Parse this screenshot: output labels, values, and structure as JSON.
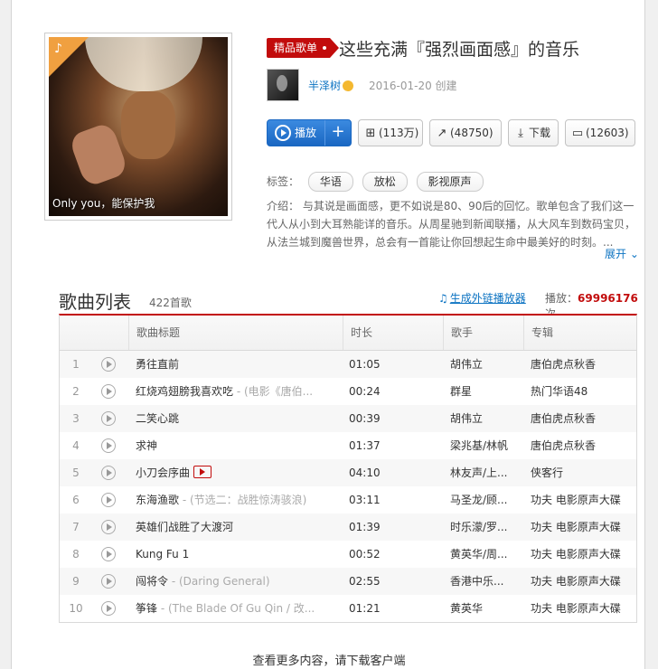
{
  "header": {
    "badge": "精品歌单",
    "title": "这些充满『强烈画面感』的音乐",
    "creator": "半泽树",
    "created": "2016-01-20 创建",
    "cover_caption": "Only you，能保护我"
  },
  "actions": {
    "play": "播放",
    "add": "+",
    "fav": "(113万)",
    "share": "(48750)",
    "download": "下载",
    "comment": "(12603)"
  },
  "tags": {
    "label": "标签：",
    "items": [
      "华语",
      "放松",
      "影视原声"
    ]
  },
  "intro": {
    "text": "介绍： 与其说是画面感，更不如说是80、90后的回忆。歌单包含了我们这一代人从小到大耳熟能详的音乐。从周星驰到新闻联播，从大风车到数码宝贝，从法兰城到魔兽世界，总会有一首能让你回想起生命中最美好的时刻。...",
    "expand": "展开"
  },
  "list": {
    "title": "歌曲列表",
    "count": "422首歌",
    "ext_link": "生成外链播放器",
    "play_label": "播放：",
    "play_count": "69996176",
    "play_unit": "次",
    "headers": [
      "歌曲标题",
      "时长",
      "歌手",
      "专辑"
    ],
    "rows": [
      {
        "num": "1",
        "title": "勇往直前",
        "sub": "",
        "dur": "01:05",
        "artist": "胡伟立",
        "album": "唐伯虎点秋香"
      },
      {
        "num": "2",
        "title": "红烧鸡翅膀我喜欢吃",
        "sub": " - (电影《唐伯...",
        "dur": "00:24",
        "artist": "群星",
        "album": "热门华语48"
      },
      {
        "num": "3",
        "title": "二笑心跳",
        "sub": "",
        "dur": "00:39",
        "artist": "胡伟立",
        "album": "唐伯虎点秋香"
      },
      {
        "num": "4",
        "title": "求神",
        "sub": "",
        "dur": "01:37",
        "artist": "梁兆基/林帆",
        "album": "唐伯虎点秋香"
      },
      {
        "num": "5",
        "title": "小刀会序曲",
        "sub": "",
        "dur": "04:10",
        "artist": "林友声/上...",
        "album": "侠客行"
      },
      {
        "num": "6",
        "title": "东海渔歌",
        "sub": " - (节选二：战胜惊涛骇浪)",
        "dur": "03:11",
        "artist": "马圣龙/顾...",
        "album": "功夫 电影原声大碟"
      },
      {
        "num": "7",
        "title": "英雄们战胜了大渡河",
        "sub": "",
        "dur": "01:39",
        "artist": "时乐濛/罗...",
        "album": "功夫 电影原声大碟"
      },
      {
        "num": "8",
        "title": "Kung Fu 1",
        "sub": "",
        "dur": "00:52",
        "artist": "黄英华/周...",
        "album": "功夫 电影原声大碟"
      },
      {
        "num": "9",
        "title": "闯将令",
        "sub": " - (Daring General)",
        "dur": "02:55",
        "artist": "香港中乐...",
        "album": "功夫 电影原声大碟"
      },
      {
        "num": "10",
        "title": "筝锋",
        "sub": " - (The Blade Of Gu Qin / 改...",
        "dur": "01:21",
        "artist": "黄英华",
        "album": "功夫 电影原声大碟"
      }
    ]
  },
  "footer": {
    "more": "查看更多内容，请下载客户端"
  }
}
